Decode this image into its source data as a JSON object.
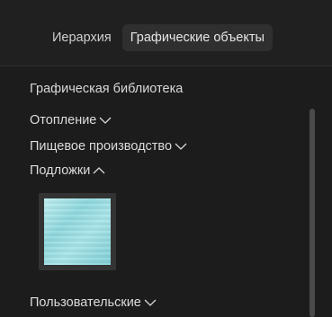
{
  "tabs": [
    {
      "label": "Иерархия",
      "active": false
    },
    {
      "label": "Графические объекты",
      "active": true
    }
  ],
  "library": {
    "title": "Графическая библиотека",
    "categories": [
      {
        "label": "Отопление",
        "expanded": false,
        "icon": "chevron-down-icon"
      },
      {
        "label": "Пищевое производство",
        "expanded": false,
        "icon": "chevron-down-icon"
      },
      {
        "label": "Подложки",
        "expanded": true,
        "icon": "chevron-up-icon"
      },
      {
        "label": "Пользовательские",
        "expanded": false,
        "icon": "chevron-down-icon"
      }
    ]
  },
  "colors": {
    "background": "#1c1c1c",
    "tab_active_bg": "#2f2f2f",
    "thumbnail_fill": "#a8e4e8"
  }
}
